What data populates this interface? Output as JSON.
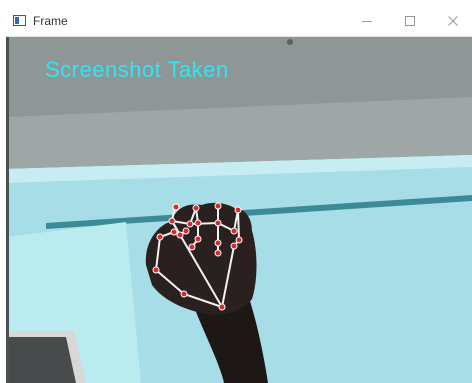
{
  "window": {
    "title": "Frame",
    "controls": {
      "minimize_icon": "minimize-icon",
      "maximize_icon": "maximize-icon",
      "close_icon": "close-icon"
    }
  },
  "camera": {
    "overlay_text": "Screenshot Taken",
    "overlay_color": "#2fe6f6",
    "landmark_color": "#d92a2a",
    "connection_color": "#f2f2f2"
  }
}
